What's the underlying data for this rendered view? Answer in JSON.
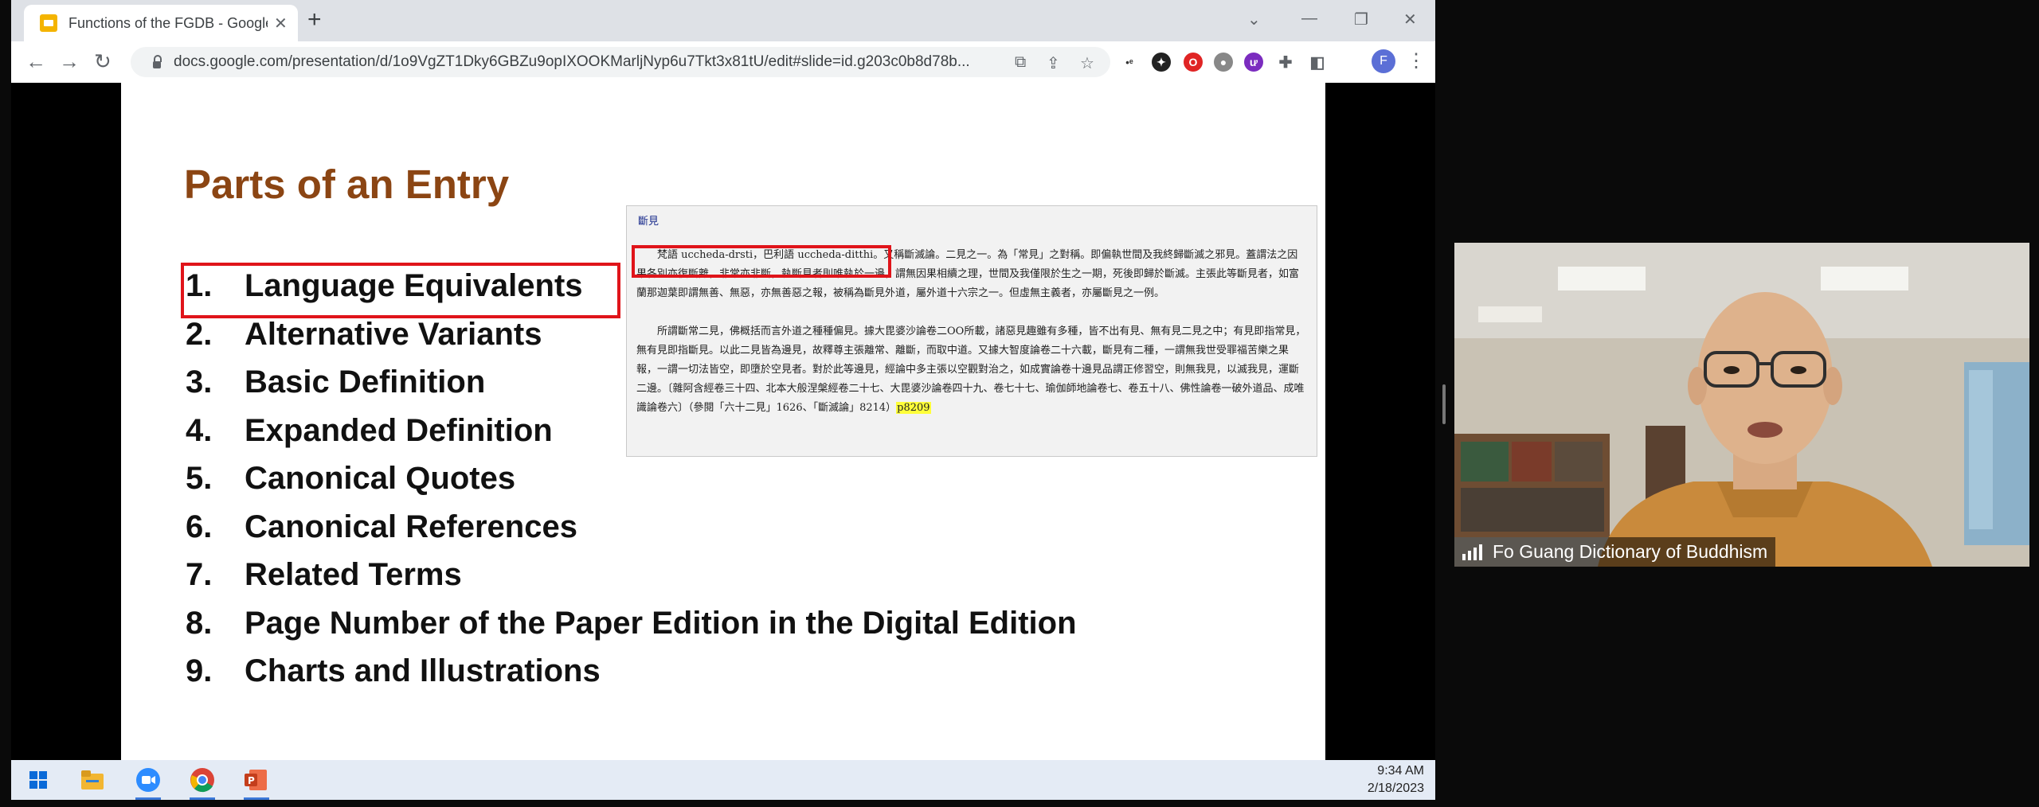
{
  "browser": {
    "tab_title": "Functions of the FGDB - Google Slid",
    "url": "docs.google.com/presentation/d/1o9VgZT1Dky6GBZu9opIXOOKMarljNyp6u7Tkt3x81tU/edit#slide=id.g203c0b8d78b..."
  },
  "slide": {
    "title": "Parts of an Entry",
    "items": [
      {
        "num": "1.",
        "text": "Language Equivalents"
      },
      {
        "num": "2.",
        "text": "Alternative Variants"
      },
      {
        "num": "3.",
        "text": "Basic Definition"
      },
      {
        "num": "4.",
        "text": "Expanded Definition"
      },
      {
        "num": "5.",
        "text": "Canonical Quotes"
      },
      {
        "num": "6.",
        "text": "Canonical References"
      },
      {
        "num": "7.",
        "text": "Related Terms"
      },
      {
        "num": "8.",
        "text": "Page Number of the Paper Edition in the Digital Edition"
      },
      {
        "num": "9.",
        "text": "Charts and Illustrations"
      }
    ],
    "excerpt": {
      "headword": "斷見",
      "para1": "　　梵語 uccheda-drsti，巴利語 uccheda-ditthi。又稱斷滅論。二見之一。為「常見」之對稱。即偏執世間及我終歸斷滅之邪見。蓋謂法之因果各別亦復斷離，非常亦非斷，執斷見者則唯執於一邊，謂無因果相續之理，世間及我僅限於生之一期，死後即歸於斷滅。主張此等斷見者，如富蘭那迦葉即謂無善、無惡，亦無善惡之報，被稱為斷見外道，屬外道十六宗之一。但虛無主義者，亦屬斷見之一例。",
      "para2": "　　所謂斷常二見，佛概括而言外道之種種偏見。據大毘婆沙論卷二OO所載，諸惡見趣雖有多種，皆不出有見、無有見二見之中；有見即指常見，無有見即指斷見。以此二見皆為邊見，故釋尊主張離常、離斷，而取中道。又據大智度論卷二十六載，斷見有二種，一謂無我世受罪福苦樂之果報，一謂一切法皆空，即墮於空見者。對於此等邊見，經論中多主張以空觀對治之，如成實論卷十邊見品謂正修習空，則無我見，以滅我見，運斷二邊。〔雜阿含經卷三十四、北本大般涅槃經卷二十七、大毘婆沙論卷四十九、卷七十七、瑜伽師地論卷七、卷五十八、佛性論卷一破外道品、成唯識論卷六〕（參閱「六十二見」1626、「斷滅論」8214）",
      "page_ref": "p8209"
    }
  },
  "taskbar": {
    "time": "9:34 AM",
    "date": "2/18/2023"
  },
  "video": {
    "participant_name": "Fo Guang Dictionary of Buddhism"
  }
}
